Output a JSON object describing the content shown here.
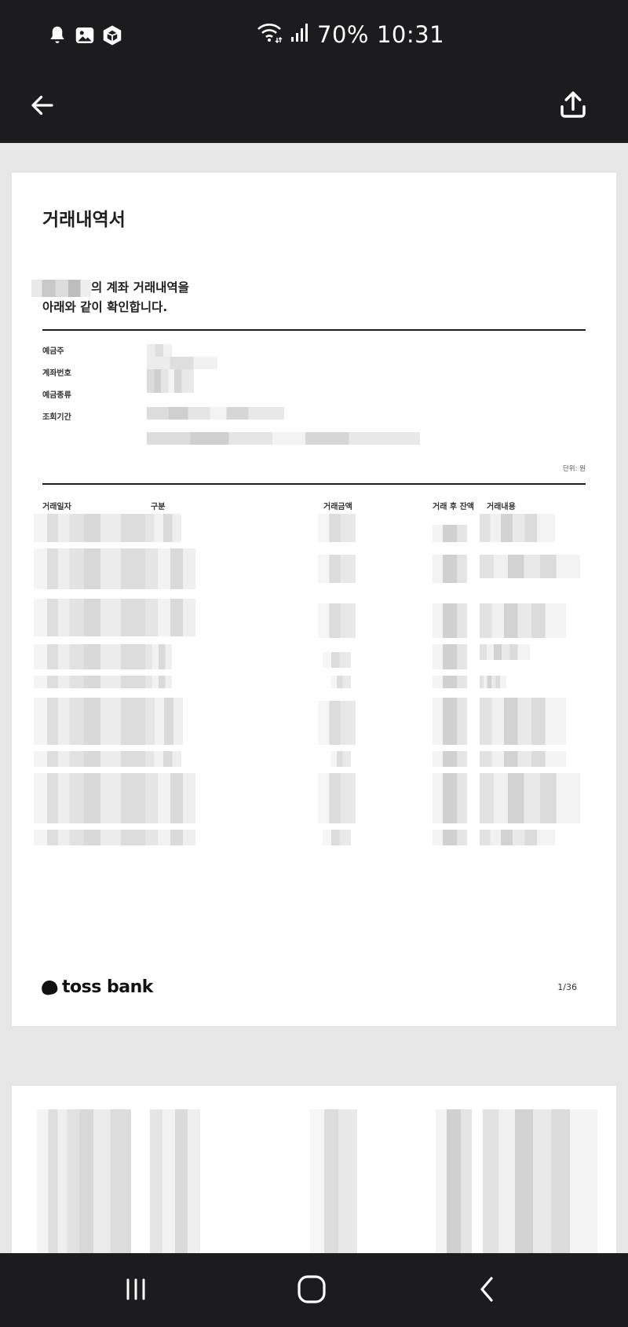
{
  "status_bar": {
    "battery": "70%",
    "time": "10:31",
    "left_icons": [
      "bell-icon",
      "image-icon",
      "cube-icon"
    ],
    "right_icons": [
      "wifi-icon",
      "signal-icon"
    ]
  },
  "app_bar": {
    "back_icon": "arrow-left-icon",
    "share_icon": "share-icon"
  },
  "statement": {
    "title": "거래내역서",
    "intro_line1_suffix": "의 계좌 거래내역을",
    "intro_line2": "아래와 같이 확인합니다.",
    "info_labels": [
      "예금주",
      "계좌번호",
      "예금종류",
      "조회기간"
    ],
    "unit_label": "단위: 원",
    "table_headers": {
      "date": "거래일자",
      "type": "구분",
      "amount": "거래금액",
      "balance": "거래 후 잔액",
      "memo": "거래내용"
    },
    "brand": "toss bank",
    "page_number": "1/36"
  },
  "nav_bar": {
    "recents_icon": "recents-icon",
    "home_icon": "home-icon",
    "back_icon": "chevron-left-icon"
  },
  "colors": {
    "system_bar": "#1c1c1e",
    "viewer_background": "#e6e6e6",
    "page": "#ffffff",
    "text": "#1f1f1f"
  }
}
